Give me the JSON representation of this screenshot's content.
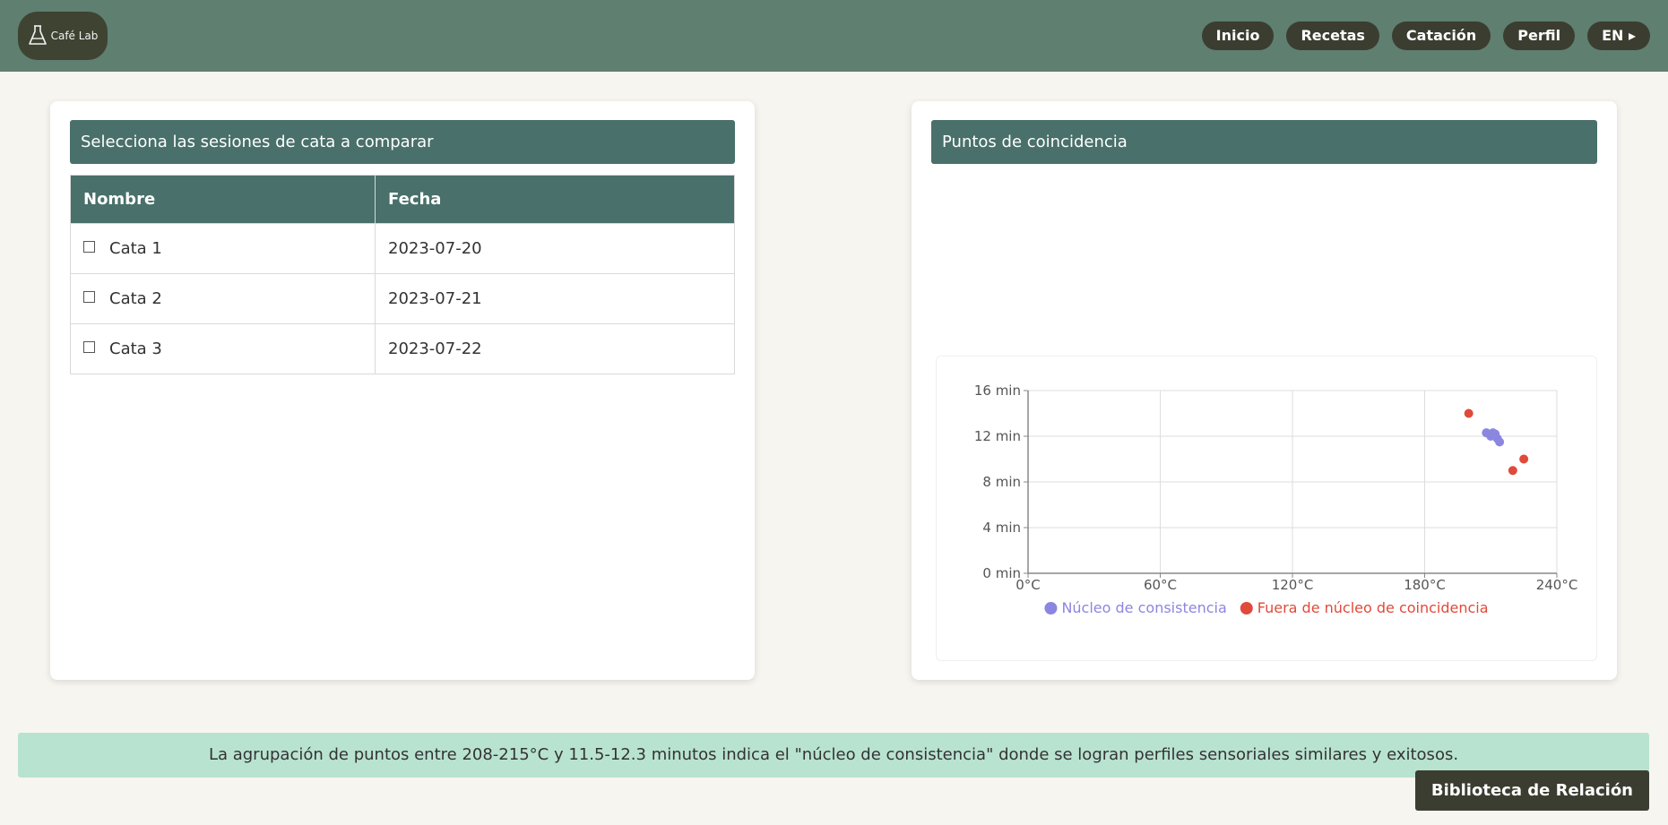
{
  "brand": {
    "name": "Café Lab",
    "icon": "coffee-dripper-icon"
  },
  "nav": {
    "items": [
      {
        "label": "Inicio"
      },
      {
        "label": "Recetas"
      },
      {
        "label": "Catación"
      },
      {
        "label": "Perfil"
      },
      {
        "label": "EN ▸"
      }
    ]
  },
  "sessions_panel": {
    "title": "Selecciona las sesiones de cata a comparar",
    "columns": [
      "Nombre",
      "Fecha"
    ],
    "rows": [
      {
        "name": "Cata 1",
        "date": "2023-07-20",
        "checked": false
      },
      {
        "name": "Cata 2",
        "date": "2023-07-21",
        "checked": false
      },
      {
        "name": "Cata 3",
        "date": "2023-07-22",
        "checked": false
      }
    ]
  },
  "chart_panel": {
    "title": "Puntos de coincidencia"
  },
  "chart_data": {
    "type": "scatter",
    "x_ticks": [
      "0°C",
      "60°C",
      "120°C",
      "180°C",
      "240°C"
    ],
    "y_ticks": [
      "0 min",
      "4 min",
      "8 min",
      "12 min",
      "16 min"
    ],
    "xlim": [
      0,
      240
    ],
    "ylim": [
      0,
      16
    ],
    "grid": true,
    "legend_position": "bottom",
    "series": [
      {
        "name": "Núcleo de consistencia",
        "color": "#8b86e0",
        "points": [
          {
            "x": 208,
            "y": 12.3
          },
          {
            "x": 210,
            "y": 12.0
          },
          {
            "x": 211,
            "y": 12.3
          },
          {
            "x": 212,
            "y": 12.2
          },
          {
            "x": 213,
            "y": 11.8
          },
          {
            "x": 214,
            "y": 11.5
          }
        ]
      },
      {
        "name": "Fuera de núcleo de coincidencia",
        "color": "#e04a3a",
        "points": [
          {
            "x": 200,
            "y": 14.0
          },
          {
            "x": 220,
            "y": 9.0
          },
          {
            "x": 225,
            "y": 10.0
          }
        ]
      }
    ]
  },
  "info": {
    "text": "La agrupación de puntos entre 208-215°C y 11.5-12.3 minutos indica el \"núcleo de consistencia\" donde se logran perfiles sensoriales similares y exitosos."
  },
  "library_button": {
    "label": "Biblioteca de Relación"
  }
}
